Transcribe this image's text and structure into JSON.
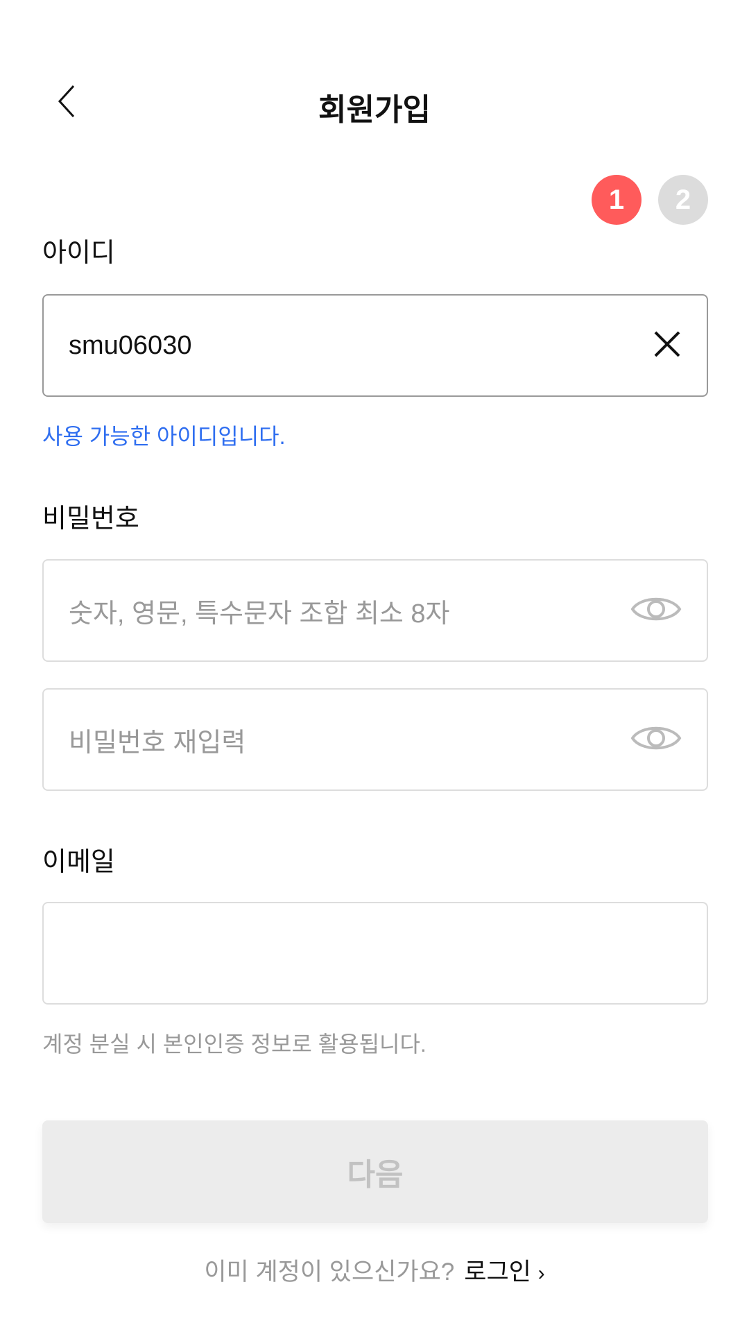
{
  "header": {
    "title": "회원가입"
  },
  "steps": [
    {
      "label": "1",
      "color": "#ff5b5b"
    },
    {
      "label": "2",
      "color": "#dcdcdc"
    }
  ],
  "id_field": {
    "label": "아이디",
    "value": "smu06030",
    "status": "사용 가능한 아이디입니다.",
    "status_color": "#2f6ef0"
  },
  "password": {
    "label": "비밀번호",
    "placeholder": "숫자, 영문, 특수문자 조합 최소 8자",
    "confirm_placeholder": "비밀번호 재입력"
  },
  "email": {
    "label": "이메일",
    "value": "",
    "hint": "계정 분실 시 본인인증 정보로 활용됩니다."
  },
  "next_button": {
    "label": "다음"
  },
  "footer": {
    "question": "이미 계정이 있으신가요?",
    "link": "로그인"
  }
}
